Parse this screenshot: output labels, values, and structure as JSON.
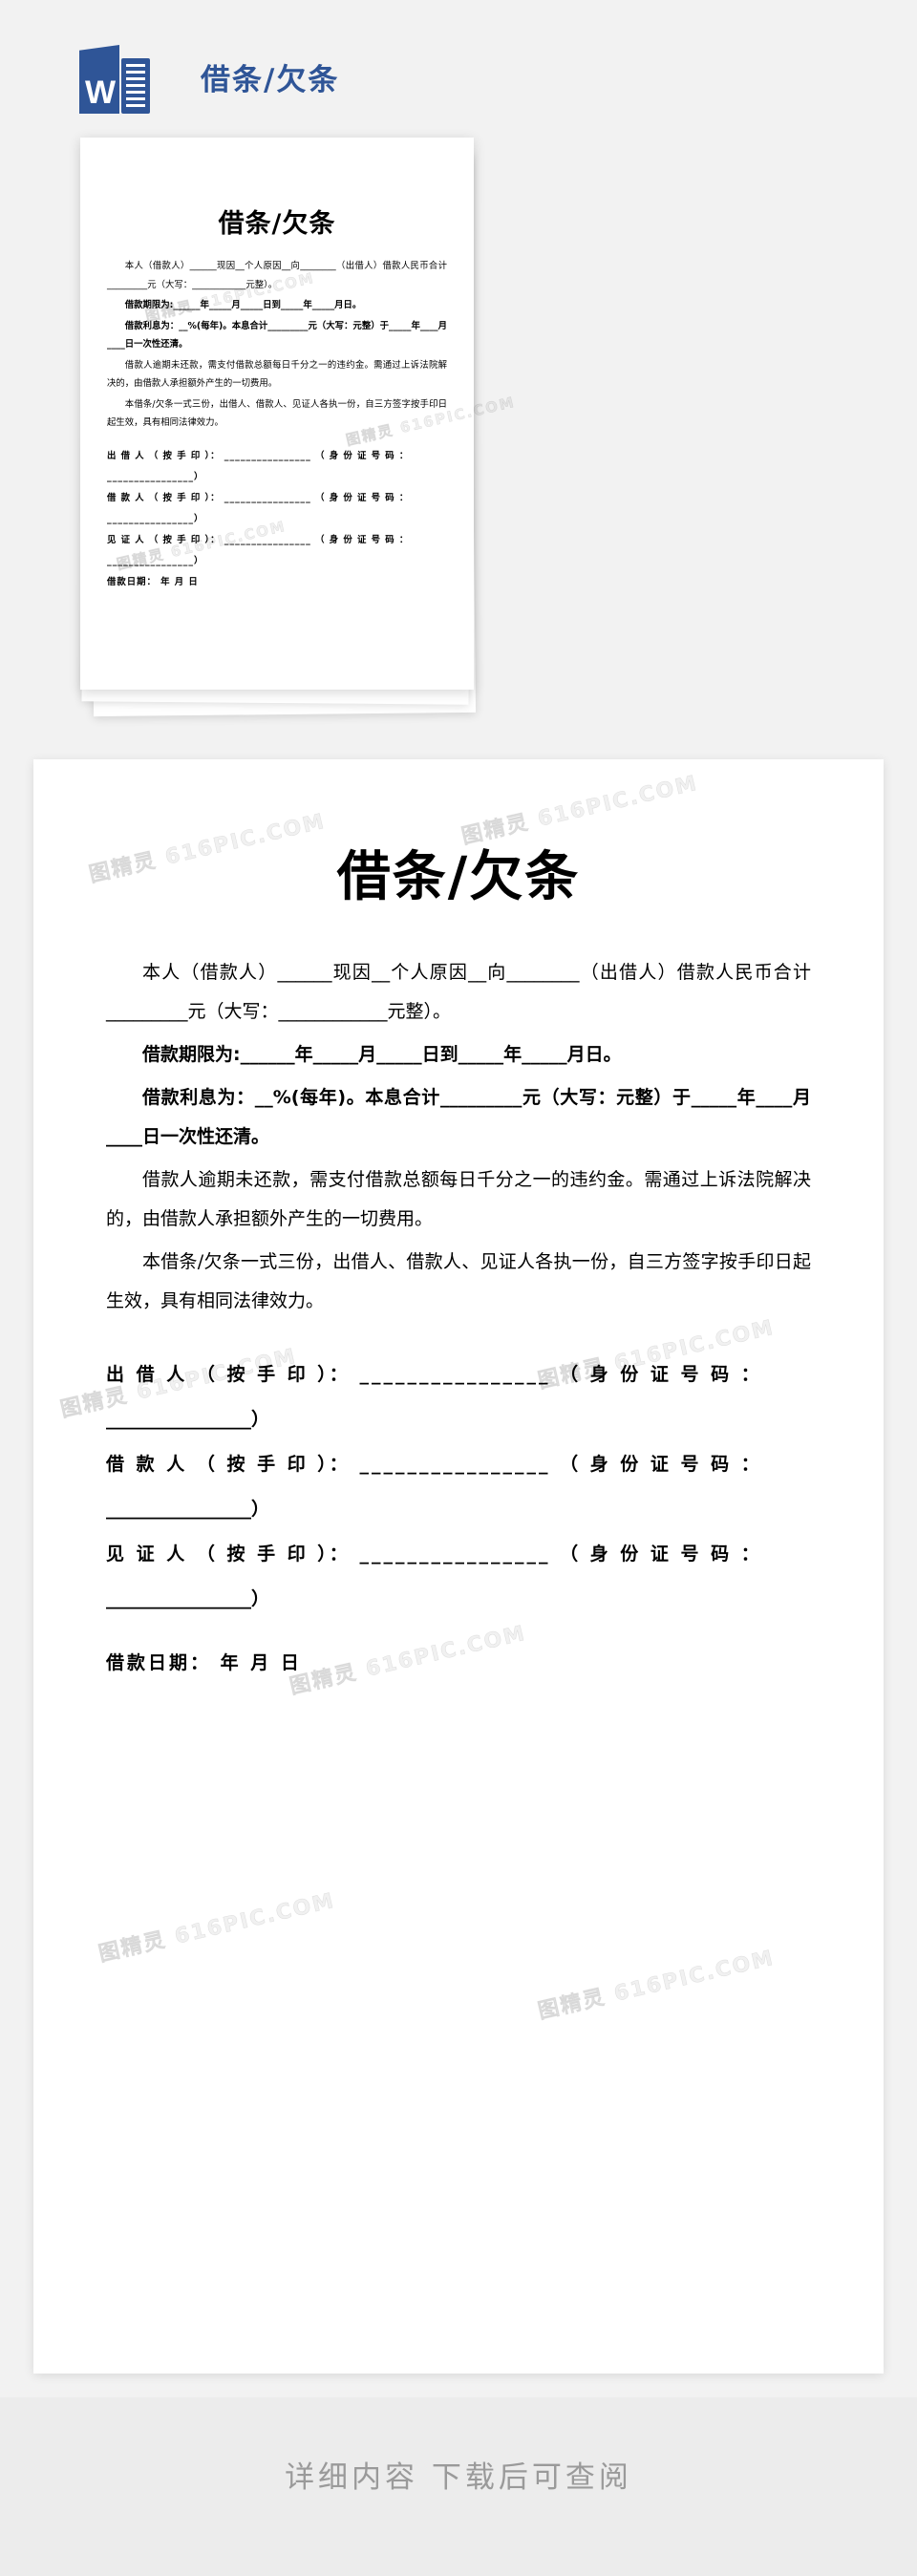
{
  "header": {
    "title": "借条/欠条",
    "icon_name": "word-document-icon",
    "accent_color": "#2f5597"
  },
  "document": {
    "title": "借条/欠条",
    "paragraphs": [
      "本人（借款人）______现因__个人原因__向________（出借人）借款人民币合计_________元（大写：____________元整）。",
      "借款期限为:______年_____月_____日到_____年_____月日。",
      "借款利息为：__%(每年)。本息合计_________元（大写：元整）于_____年____月____日一次性还清。",
      "借款人逾期未还款，需支付借款总额每日千分之一的违约金。需通过上诉法院解决的，由借款人承担额外产生的一切费用。",
      "本借条/欠条一式三份，出借人、借款人、见证人各执一份，自三方签字按手印日起生效，具有相同法律效力。"
    ],
    "paragraph_styles": [
      "indent",
      "bold",
      "bold",
      "indent",
      "indent"
    ],
    "signatures": [
      {
        "label": "出 借 人 （ 按 手 印 ）：",
        "line": "________________",
        "id_label": "（ 身 份 证 号 码 ：",
        "id_line": "________________）"
      },
      {
        "label": "借 款 人 （ 按 手 印 ）：",
        "line": "________________",
        "id_label": "（ 身 份 证 号 码 ：",
        "id_line": "________________）"
      },
      {
        "label": "见 证 人 （ 按 手 印 ）：",
        "line": "________________",
        "id_label": "（ 身 份 证 号 码 ：",
        "id_line": "________________）"
      }
    ],
    "date_line": "借款日期：      年  月  日"
  },
  "watermark": {
    "text": "图精灵 616PIC.COM",
    "color": "#000000"
  },
  "footer": {
    "text": "详细内容 下载后可查阅",
    "background": "#ececec",
    "color": "#9a9a9a"
  }
}
